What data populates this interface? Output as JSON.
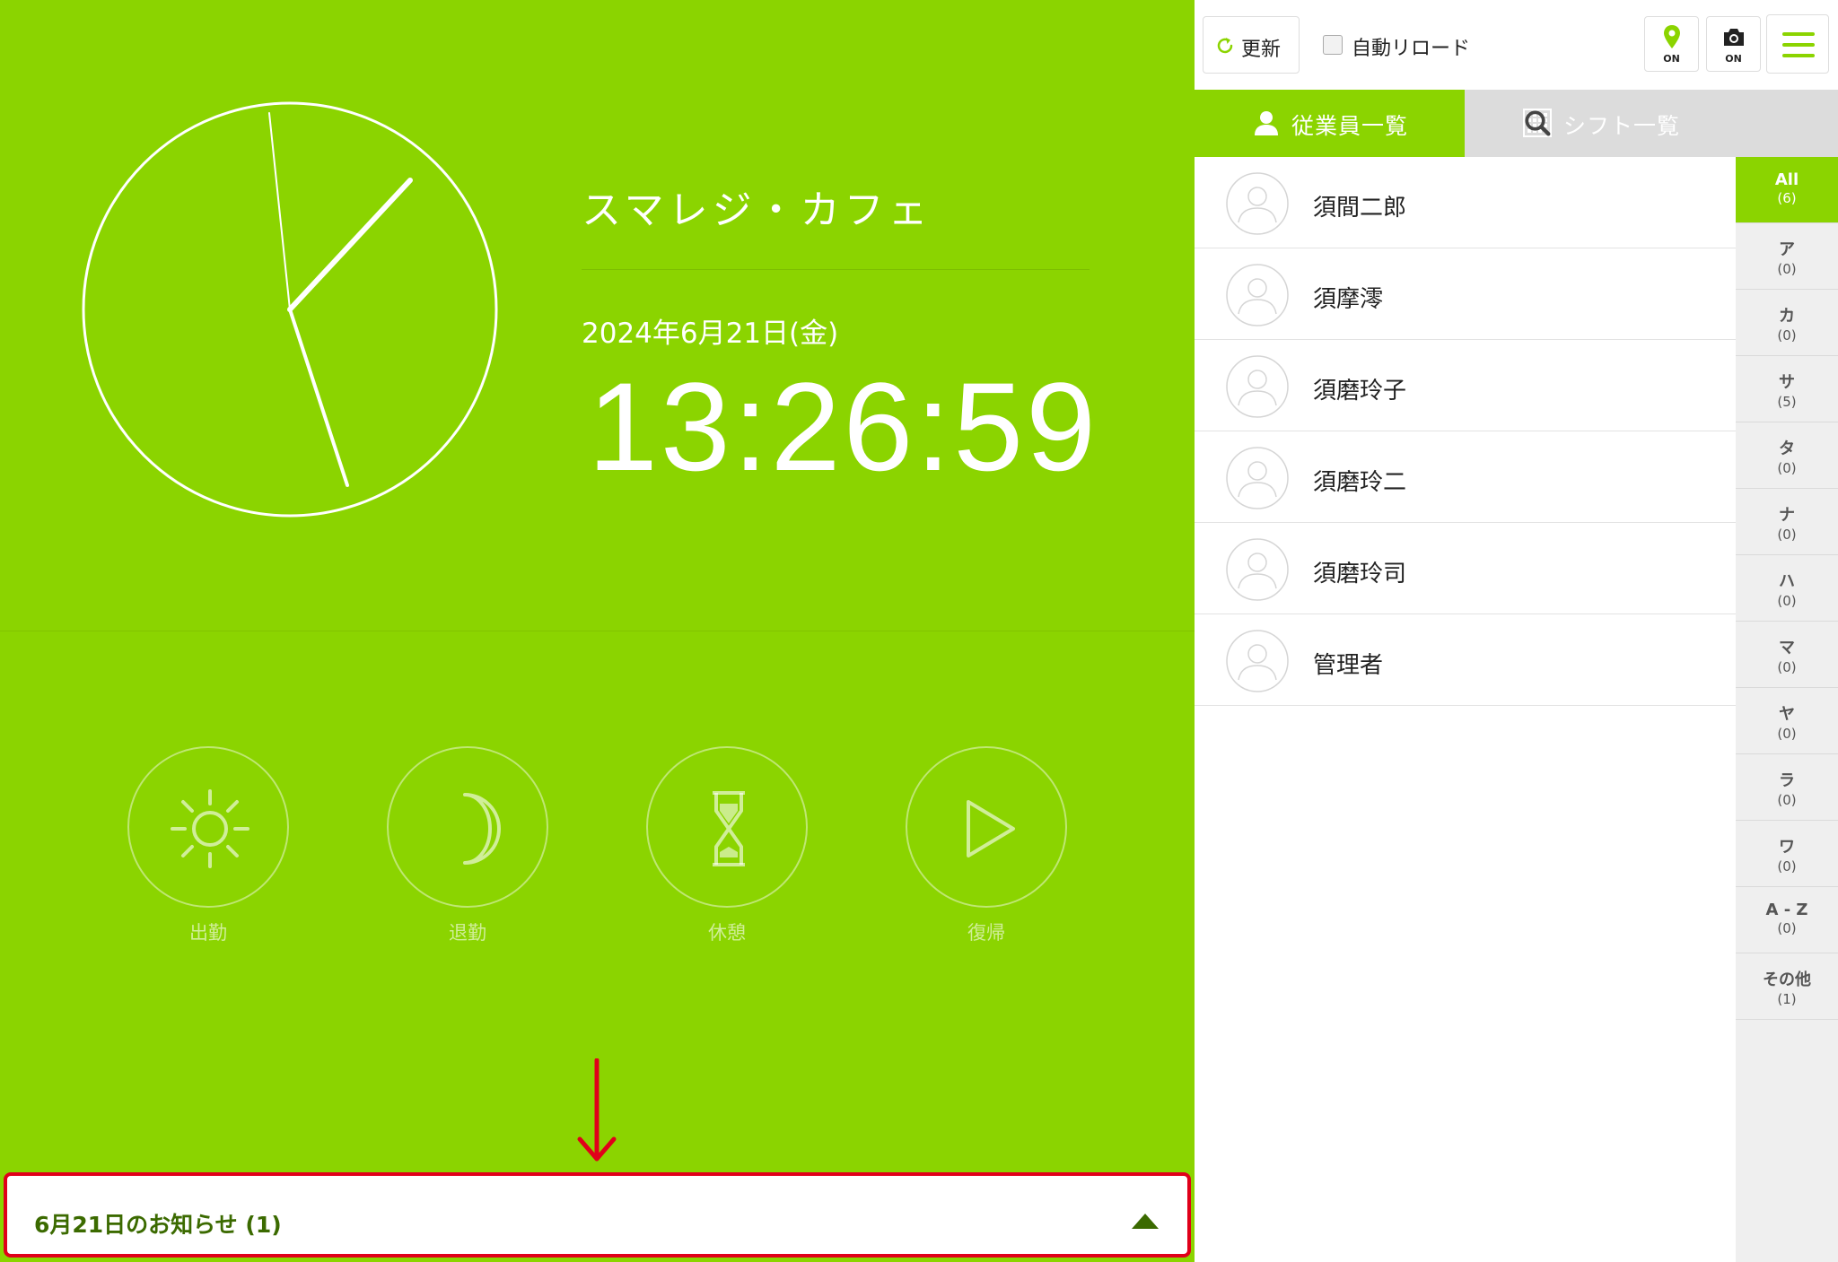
{
  "left": {
    "store_name": "スマレジ・カフェ",
    "date": "2024年6月21日(金)",
    "time": "13:26:59",
    "actions": [
      {
        "label": "出勤",
        "icon": "sun-icon"
      },
      {
        "label": "退勤",
        "icon": "moon-icon"
      },
      {
        "label": "休憩",
        "icon": "hourglass-icon"
      },
      {
        "label": "復帰",
        "icon": "play-icon"
      }
    ],
    "notice": {
      "label": "6月21日のお知らせ (1)"
    }
  },
  "toolbar": {
    "refresh_label": "更新",
    "auto_reload_label": "自動リロード",
    "location_status": "ON",
    "camera_status": "ON"
  },
  "tabs": {
    "employees": "従業員一覧",
    "shifts": "シフト一覧"
  },
  "employees": [
    {
      "name": "須間二郎"
    },
    {
      "name": "須摩澪"
    },
    {
      "name": "須磨玲子"
    },
    {
      "name": "須磨玲二"
    },
    {
      "name": "須磨玲司"
    },
    {
      "name": "管理者"
    }
  ],
  "index": [
    {
      "key": "All",
      "count": "(6)",
      "active": true
    },
    {
      "key": "ア",
      "count": "(0)"
    },
    {
      "key": "カ",
      "count": "(0)"
    },
    {
      "key": "サ",
      "count": "(5)"
    },
    {
      "key": "タ",
      "count": "(0)"
    },
    {
      "key": "ナ",
      "count": "(0)"
    },
    {
      "key": "ハ",
      "count": "(0)"
    },
    {
      "key": "マ",
      "count": "(0)"
    },
    {
      "key": "ヤ",
      "count": "(0)"
    },
    {
      "key": "ラ",
      "count": "(0)"
    },
    {
      "key": "ワ",
      "count": "(0)"
    },
    {
      "key": "A - Z",
      "count": "(0)"
    },
    {
      "key": "その他",
      "count": "(1)"
    }
  ],
  "colors": {
    "brand_green": "#8bd400",
    "notice_text": "#3b6a00",
    "highlight_red": "#e0001a"
  }
}
